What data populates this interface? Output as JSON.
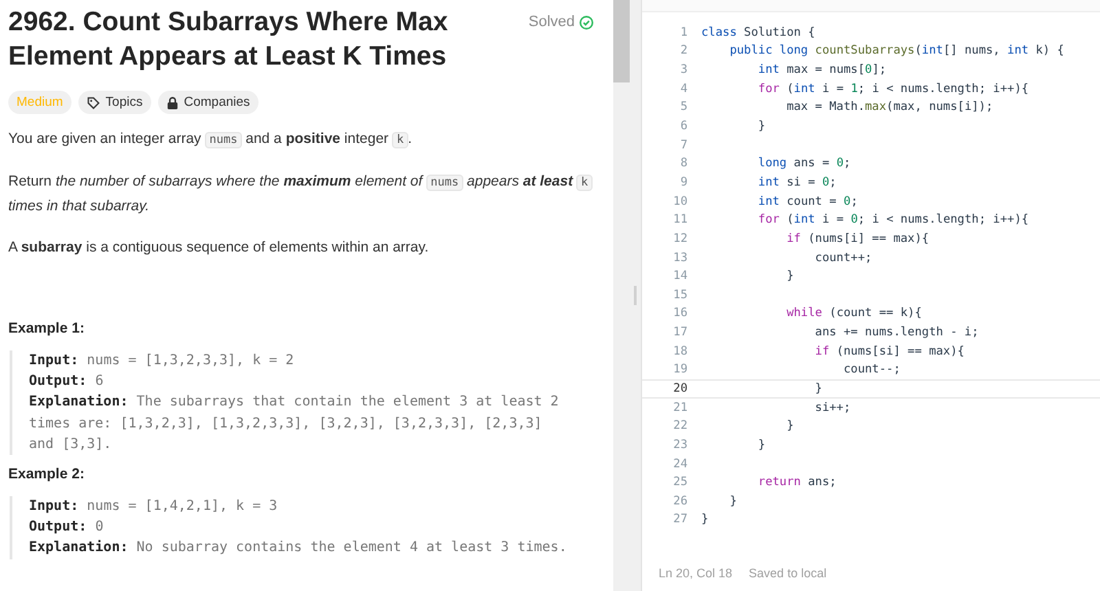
{
  "problem": {
    "title": "2962. Count Subarrays Where Max Element Appears at Least K Times",
    "status": {
      "label": "Solved",
      "solved": true
    },
    "tags": [
      {
        "kind": "difficulty",
        "label": "Medium"
      },
      {
        "kind": "topics",
        "label": "Topics"
      },
      {
        "kind": "companies",
        "label": "Companies"
      }
    ],
    "paragraphs": [
      [
        {
          "kind": "text",
          "t": "You are given an integer array "
        },
        {
          "kind": "code",
          "t": "nums"
        },
        {
          "kind": "text",
          "t": " and a **positive** integer "
        },
        {
          "kind": "code",
          "t": "k"
        },
        {
          "kind": "text",
          "t": "."
        }
      ],
      [
        {
          "kind": "text",
          "t": "Return "
        },
        {
          "kind": "em",
          "t": "the number of subarrays where the **maximum** element of "
        },
        {
          "kind": "code",
          "t": "nums"
        },
        {
          "kind": "em",
          "t": " appears **at least** "
        },
        {
          "kind": "code",
          "t": "k"
        },
        {
          "kind": "em",
          "t": " times in that subarray."
        }
      ],
      [
        {
          "kind": "text",
          "t": "A **subarray** is a contiguous sequence of elements within an array."
        }
      ]
    ],
    "examples": [
      {
        "title": "Example 1:",
        "lines": [
          {
            "label": "Input:",
            "value": "nums = [1,3,2,3,3], k = 2"
          },
          {
            "label": "Output:",
            "value": "6"
          },
          {
            "label": "Explanation:",
            "value": "The subarrays that contain the element 3 at least 2 times are: [1,3,2,3], [1,3,2,3,3], [3,2,3], [3,2,3,3], [2,3,3] and [3,3]."
          }
        ]
      },
      {
        "title": "Example 2:",
        "lines": [
          {
            "label": "Input:",
            "value": "nums = [1,4,2,1], k = 3"
          },
          {
            "label": "Output:",
            "value": "0"
          },
          {
            "label": "Explanation:",
            "value": "No subarray contains the element 4 at least 3 times."
          }
        ]
      }
    ]
  },
  "editor": {
    "lines": [
      {
        "n": "1",
        "current": false,
        "tokens": [
          {
            "kind": "kw",
            "t": "class"
          },
          {
            "kind": "p",
            "t": " Solution {"
          }
        ]
      },
      {
        "n": "2",
        "current": false,
        "tokens": [
          {
            "kind": "kw",
            "t": "    public long "
          },
          {
            "kind": "fn",
            "t": "countSubarrays"
          },
          {
            "kind": "p",
            "t": "("
          },
          {
            "kind": "kw",
            "t": "int"
          },
          {
            "kind": "p",
            "t": "[] nums, "
          },
          {
            "kind": "kw",
            "t": "int"
          },
          {
            "kind": "p",
            "t": " k) {"
          }
        ]
      },
      {
        "n": "3",
        "current": false,
        "tokens": [
          {
            "kind": "kw",
            "t": "        int"
          },
          {
            "kind": "p",
            "t": " max = nums["
          },
          {
            "kind": "num",
            "t": "0"
          },
          {
            "kind": "p",
            "t": "];"
          }
        ]
      },
      {
        "n": "4",
        "current": false,
        "tokens": [
          {
            "kind": "ctl",
            "t": "        for"
          },
          {
            "kind": "p",
            "t": " ("
          },
          {
            "kind": "kw",
            "t": "int"
          },
          {
            "kind": "p",
            "t": " i = "
          },
          {
            "kind": "num",
            "t": "1"
          },
          {
            "kind": "p",
            "t": "; i < nums.length; i++){"
          }
        ]
      },
      {
        "n": "5",
        "current": false,
        "tokens": [
          {
            "kind": "p",
            "t": "            max = Math."
          },
          {
            "kind": "fn",
            "t": "max"
          },
          {
            "kind": "p",
            "t": "(max, nums[i]);"
          }
        ]
      },
      {
        "n": "6",
        "current": false,
        "tokens": [
          {
            "kind": "p",
            "t": "        }"
          }
        ]
      },
      {
        "n": "7",
        "current": false
      },
      {
        "n": "8",
        "current": false,
        "tokens": [
          {
            "kind": "kw",
            "t": "        long"
          },
          {
            "kind": "p",
            "t": " ans = "
          },
          {
            "kind": "num",
            "t": "0"
          },
          {
            "kind": "p",
            "t": ";"
          }
        ]
      },
      {
        "n": "9",
        "current": false,
        "tokens": [
          {
            "kind": "kw",
            "t": "        int"
          },
          {
            "kind": "p",
            "t": " si = "
          },
          {
            "kind": "num",
            "t": "0"
          },
          {
            "kind": "p",
            "t": ";"
          }
        ]
      },
      {
        "n": "10",
        "current": false,
        "tokens": [
          {
            "kind": "kw",
            "t": "        int"
          },
          {
            "kind": "p",
            "t": " count = "
          },
          {
            "kind": "num",
            "t": "0"
          },
          {
            "kind": "p",
            "t": ";"
          }
        ]
      },
      {
        "n": "11",
        "current": false,
        "tokens": [
          {
            "kind": "ctl",
            "t": "        for"
          },
          {
            "kind": "p",
            "t": " ("
          },
          {
            "kind": "kw",
            "t": "int"
          },
          {
            "kind": "p",
            "t": " i = "
          },
          {
            "kind": "num",
            "t": "0"
          },
          {
            "kind": "p",
            "t": "; i < nums.length; i++){"
          }
        ]
      },
      {
        "n": "12",
        "current": false,
        "tokens": [
          {
            "kind": "ctl",
            "t": "            if"
          },
          {
            "kind": "p",
            "t": " (nums[i] == max){"
          }
        ]
      },
      {
        "n": "13",
        "current": false,
        "tokens": [
          {
            "kind": "p",
            "t": "                count++;"
          }
        ]
      },
      {
        "n": "14",
        "current": false,
        "tokens": [
          {
            "kind": "p",
            "t": "            }"
          }
        ]
      },
      {
        "n": "15",
        "current": false
      },
      {
        "n": "16",
        "current": false,
        "tokens": [
          {
            "kind": "ctl",
            "t": "            while"
          },
          {
            "kind": "p",
            "t": " (count == k){"
          }
        ]
      },
      {
        "n": "17",
        "current": false,
        "tokens": [
          {
            "kind": "p",
            "t": "                ans += nums.length - i;"
          }
        ]
      },
      {
        "n": "18",
        "current": false,
        "tokens": [
          {
            "kind": "ctl",
            "t": "                if"
          },
          {
            "kind": "p",
            "t": " (nums[si] == max){"
          }
        ]
      },
      {
        "n": "19",
        "current": false,
        "tokens": [
          {
            "kind": "p",
            "t": "                    count--;"
          }
        ]
      },
      {
        "n": "20",
        "current": true,
        "tokens": [
          {
            "kind": "p",
            "t": "                }"
          }
        ]
      },
      {
        "n": "21",
        "current": false,
        "tokens": [
          {
            "kind": "p",
            "t": "                si++;"
          }
        ]
      },
      {
        "n": "22",
        "current": false,
        "tokens": [
          {
            "kind": "p",
            "t": "            }"
          }
        ]
      },
      {
        "n": "23",
        "current": false,
        "tokens": [
          {
            "kind": "p",
            "t": "        }"
          }
        ]
      },
      {
        "n": "24",
        "current": false
      },
      {
        "n": "25",
        "current": false,
        "tokens": [
          {
            "kind": "ctl",
            "t": "        return"
          },
          {
            "kind": "p",
            "t": " ans;"
          }
        ]
      },
      {
        "n": "26",
        "current": false,
        "tokens": [
          {
            "kind": "p",
            "t": "    }"
          }
        ]
      },
      {
        "n": "27",
        "current": false,
        "tokens": [
          {
            "kind": "p",
            "t": "}"
          }
        ]
      }
    ],
    "status_bar": {
      "position": "Ln 20, Col 18",
      "save_state": "Saved to local"
    }
  }
}
